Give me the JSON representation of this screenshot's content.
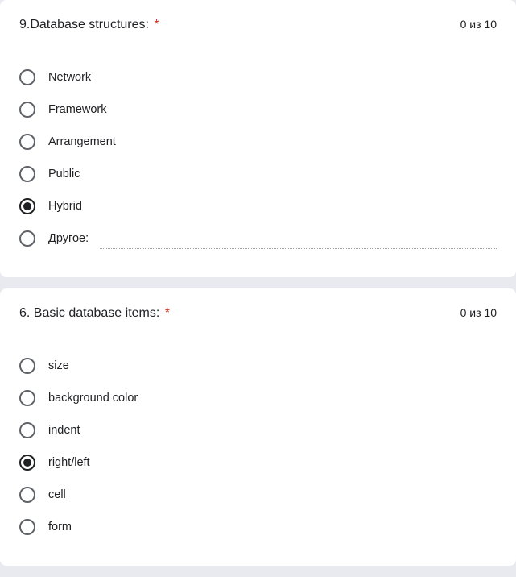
{
  "questions": [
    {
      "title": "9.Database structures:",
      "required": "*",
      "points": "0 из 10",
      "selected_index": 4,
      "options": [
        {
          "label": "Network"
        },
        {
          "label": "Framework"
        },
        {
          "label": "Arrangement"
        },
        {
          "label": "Public"
        },
        {
          "label": "Hybrid"
        }
      ],
      "other": {
        "label": "Другое:",
        "value": ""
      }
    },
    {
      "title": "6. Basic database items:",
      "required": "*",
      "points": "0 из 10",
      "selected_index": 3,
      "options": [
        {
          "label": "size"
        },
        {
          "label": "background color"
        },
        {
          "label": "indent"
        },
        {
          "label": "right/left"
        },
        {
          "label": "cell"
        },
        {
          "label": "form"
        }
      ],
      "other": null
    }
  ]
}
